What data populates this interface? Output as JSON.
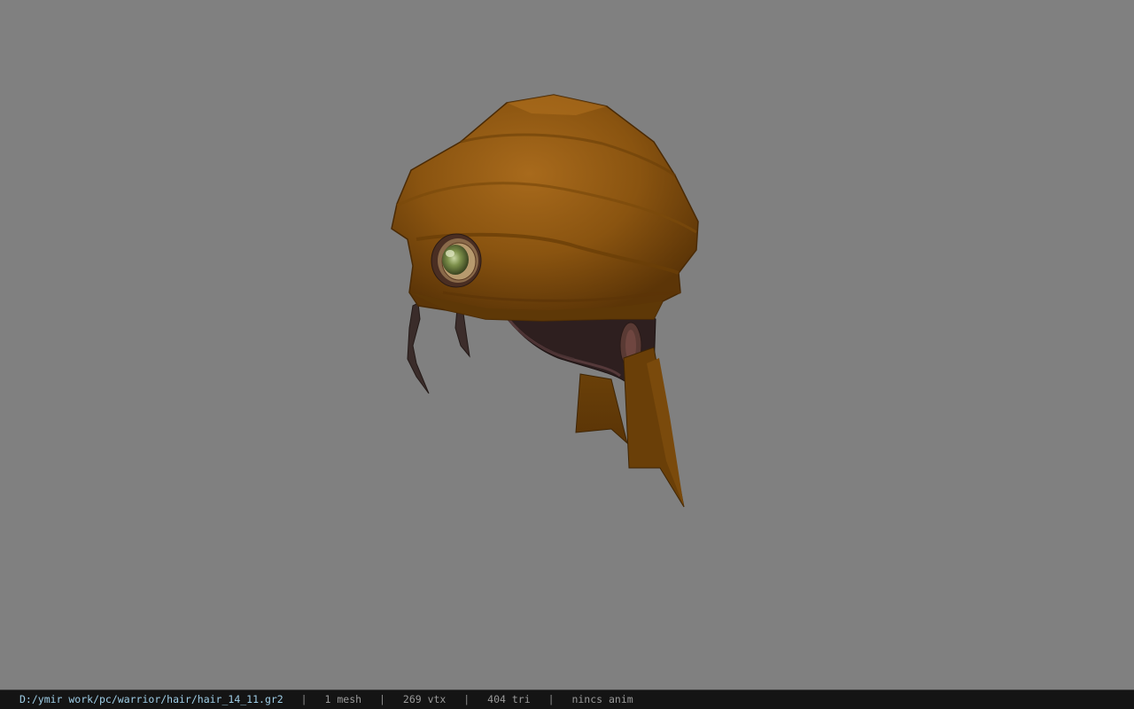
{
  "viewport": {
    "background_color": "#808080",
    "model": "bandana-hair-icon"
  },
  "statusbar": {
    "file_path": "D:/ymir work/pc/warrior/hair/hair_14_11.gr2",
    "separator": "|",
    "mesh_count": "1 mesh",
    "vertex_count": "269 vtx",
    "triangle_count": "404 tri",
    "animation_status": "nincs anim",
    "path_color": "#9ecde6",
    "background_color": "#141414"
  }
}
